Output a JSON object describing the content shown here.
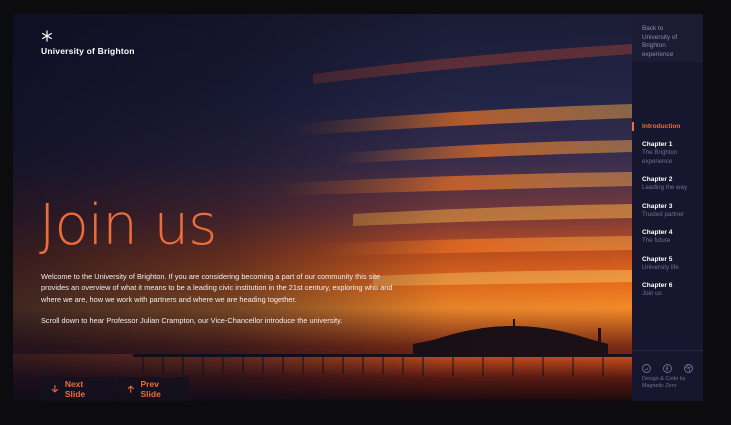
{
  "brand": {
    "name": "University of Brighton"
  },
  "hero": {
    "title": "Join us",
    "paragraphs": [
      "Welcome to the University of Brighton. If you are considering becoming a part of our community this site provides an overview of what it means to be a leading civic institution in the 21st century, exploring who and where we are, how we work with partners and where we are heading together.",
      "Scroll down to hear Professor Julian Crampton, our Vice-Chancellor introduce the university."
    ],
    "next_label": "Next Slide",
    "prev_label": "Prev Slide"
  },
  "sidebar": {
    "back_label": "Back to University of Brighton experience",
    "items": [
      {
        "chapter": "Introduction",
        "subtitle": "",
        "active": true
      },
      {
        "chapter": "Chapter 1",
        "subtitle": "The Brighton experience",
        "active": false
      },
      {
        "chapter": "Chapter 2",
        "subtitle": "Leading the way",
        "active": false
      },
      {
        "chapter": "Chapter 3",
        "subtitle": "Trusted partner",
        "active": false
      },
      {
        "chapter": "Chapter 4",
        "subtitle": "The future",
        "active": false
      },
      {
        "chapter": "Chapter 5",
        "subtitle": "University life",
        "active": false
      },
      {
        "chapter": "Chapter 6",
        "subtitle": "Join us",
        "active": false
      }
    ],
    "social_icons": [
      "twitter-icon",
      "facebook-icon",
      "dribbble-icon"
    ],
    "credit": "Design & Code by Magnetic Zero"
  },
  "colors": {
    "accent": "#ec6d3a",
    "sidebar_bg": "#16172e"
  }
}
